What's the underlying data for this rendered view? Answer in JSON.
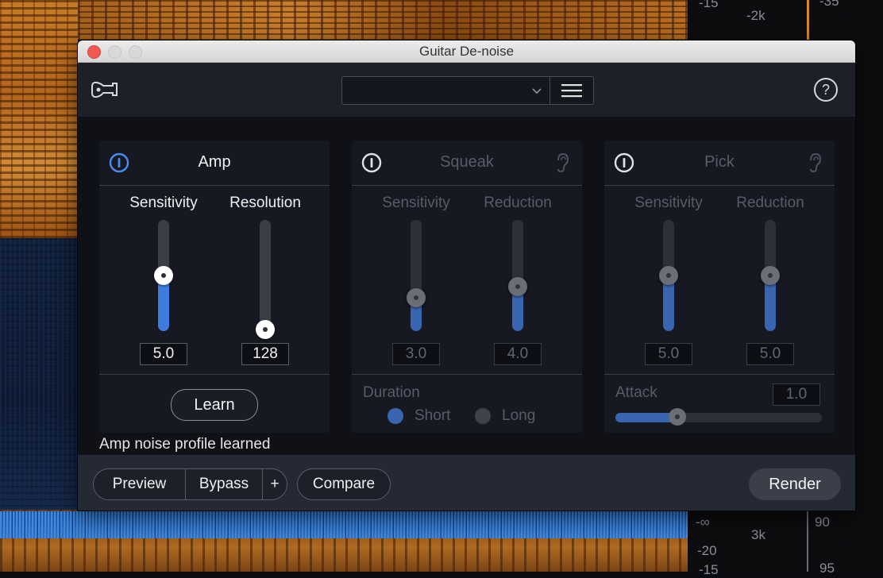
{
  "window": {
    "title": "Guitar De-noise"
  },
  "toolbar": {
    "preset_value": "",
    "icons": [
      "guitar-icon",
      "chevron-down-icon",
      "hamburger-menu-icon",
      "help-icon"
    ]
  },
  "modules": {
    "amp": {
      "title": "Amp",
      "enabled": true,
      "left_label": "Sensitivity",
      "right_label": "Resolution",
      "left_value": "5.0",
      "right_value": "128",
      "left_level": 0.5,
      "right_level": 0.0,
      "learn_label": "Learn"
    },
    "squeak": {
      "title": "Squeak",
      "enabled": false,
      "left_label": "Sensitivity",
      "right_label": "Reduction",
      "left_value": "3.0",
      "right_value": "4.0",
      "left_level": 0.3,
      "right_level": 0.4,
      "duration_label": "Duration",
      "options": [
        "Short",
        "Long"
      ],
      "selected": "Short"
    },
    "pick": {
      "title": "Pick",
      "enabled": false,
      "left_label": "Sensitivity",
      "right_label": "Reduction",
      "left_value": "5.0",
      "right_value": "5.0",
      "left_level": 0.5,
      "right_level": 0.5,
      "attack_label": "Attack",
      "attack_value": "1.0",
      "attack_level": 0.3
    }
  },
  "status": {
    "text": "Amp noise profile learned"
  },
  "bottombar": {
    "preview_label": "Preview",
    "bypass_label": "Bypass",
    "plus_label": "+",
    "compare_label": "Compare",
    "render_label": "Render"
  },
  "background": {
    "meter_labels": [
      "-15",
      "-2k",
      "-35",
      "-∞",
      "3k",
      "90",
      "-20",
      "-15",
      "95"
    ]
  },
  "colors": {
    "accent": "#3d7bdf",
    "power_active": "#4a8cf0",
    "text": "#f0f0f0"
  }
}
